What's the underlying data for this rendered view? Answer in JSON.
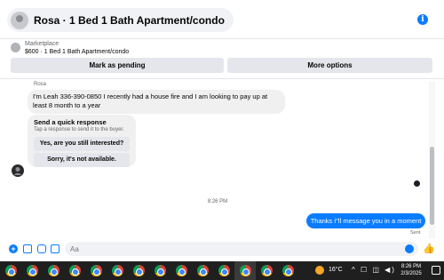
{
  "header": {
    "title": "Rosa · 1 Bed 1 Bath Apartment/condo",
    "info_icon": "i"
  },
  "listing": {
    "label": "Marketplace",
    "title": "$600 · 1 Bed 1 Bath Apartment/condo",
    "mark_pending_label": "Mark as pending",
    "more_options_label": "More options"
  },
  "chat": {
    "sender_name": "Rosa",
    "incoming_message": "I'm Leah 336-390-0850 I recently had a house fire and I am looking to pay up at least 8 month to a year",
    "quick_response": {
      "title": "Send a quick response",
      "subtitle": "Tap a response to send it to the buyer.",
      "options": [
        "Yes, are you still interested?",
        "Sorry, it's not available."
      ]
    },
    "timestamp": "8:26 PM",
    "outgoing_message": "Thanks i''ll message you in a moment",
    "status": "Sent"
  },
  "composer": {
    "placeholder": "Aa",
    "plus_icon": "+"
  },
  "taskbar": {
    "temperature": "16°C",
    "tray_icons": "^ ☐ ◫ ◀)",
    "time": "8:26 PM",
    "date": "2/3/2025",
    "app_count": 14
  },
  "colors": {
    "accent": "#0a7cff",
    "bubble_gray": "#f0f0f0",
    "taskbar": "#1f1f1f"
  }
}
